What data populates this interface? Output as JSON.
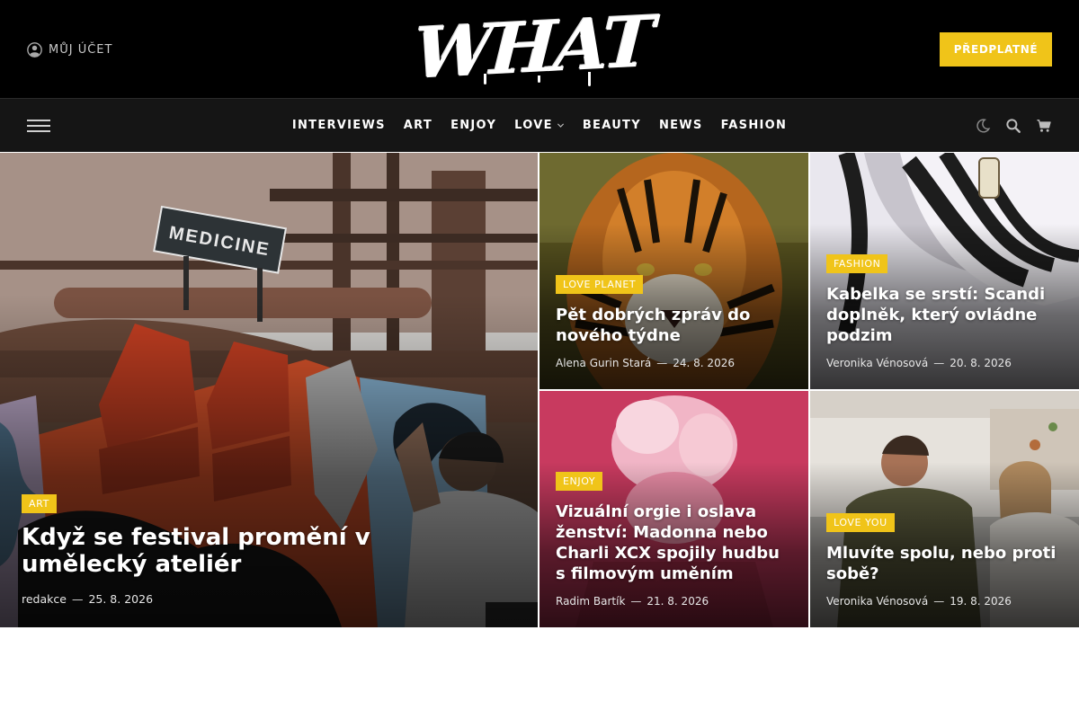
{
  "header": {
    "account_label": "Můj účet",
    "logo_text": "WHAT",
    "subscribe_label": "Předplatné"
  },
  "nav": {
    "items": [
      {
        "label": "Interviews",
        "has_dropdown": false
      },
      {
        "label": "Art",
        "has_dropdown": false
      },
      {
        "label": "Enjoy",
        "has_dropdown": false
      },
      {
        "label": "Love",
        "has_dropdown": true
      },
      {
        "label": "Beauty",
        "has_dropdown": false
      },
      {
        "label": "News",
        "has_dropdown": false
      },
      {
        "label": "Fashion",
        "has_dropdown": false
      }
    ],
    "tools": [
      "moon-icon",
      "search-icon",
      "cart-icon"
    ]
  },
  "colors": {
    "accent": "#f0c419",
    "topbar_bg": "#000000",
    "navbar_bg": "#151515"
  },
  "articles": [
    {
      "category": "Art",
      "title": "Když se festival promění v umělecký ateliér",
      "author": "redakce",
      "date": "25. 8. 2026"
    },
    {
      "category": "Love Planet",
      "title": "Pět dobrých zpráv do nového týdne",
      "author": "Alena Gurin Stará",
      "date": "24. 8. 2026"
    },
    {
      "category": "Fashion",
      "title": "Kabelka se srstí: Scandi doplněk, který ovládne podzim",
      "author": "Veronika Vénosová",
      "date": "20. 8. 2026"
    },
    {
      "category": "Enjoy",
      "title": "Vizuální orgie i oslava ženství: Madonna nebo Charli XCX spojily hudbu s filmovým uměním",
      "author": "Radim Bartík",
      "date": "21. 8. 2026"
    },
    {
      "category": "Love You",
      "title": "Mluvíte spolu, nebo proti sobě?",
      "author": "Veronika Vénosová",
      "date": "19. 8. 2026"
    }
  ],
  "meta_separator": "—"
}
